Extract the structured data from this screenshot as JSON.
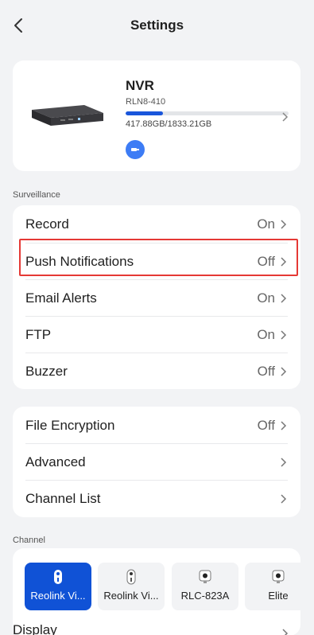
{
  "header": {
    "title": "Settings"
  },
  "device": {
    "name": "NVR",
    "model": "RLN8-410",
    "storage_text": "417.88GB/1833.21GB",
    "storage_used_fraction": 0.228
  },
  "surveillance": {
    "label": "Surveillance",
    "rows": [
      {
        "label": "Record",
        "value": "On"
      },
      {
        "label": "Push Notifications",
        "value": "Off"
      },
      {
        "label": "Email Alerts",
        "value": "On"
      },
      {
        "label": "FTP",
        "value": "On"
      },
      {
        "label": "Buzzer",
        "value": "Off"
      }
    ]
  },
  "system": {
    "rows": [
      {
        "label": "File Encryption",
        "value": "Off"
      },
      {
        "label": "Advanced",
        "value": ""
      },
      {
        "label": "Channel List",
        "value": ""
      }
    ]
  },
  "channel": {
    "label": "Channel",
    "tiles": [
      {
        "name": "Reolink Vi...",
        "icon": "doorbell-camera-icon",
        "active": true
      },
      {
        "name": "Reolink Vi...",
        "icon": "doorbell-camera-icon",
        "active": false
      },
      {
        "name": "RLC-823A",
        "icon": "camera-icon",
        "active": false
      },
      {
        "name": "Elite",
        "icon": "camera-icon",
        "active": false
      }
    ],
    "display_label": "Display"
  },
  "colors": {
    "accent": "#1052d6",
    "highlight": "#e53935",
    "usb_button": "#3d7cf5"
  }
}
